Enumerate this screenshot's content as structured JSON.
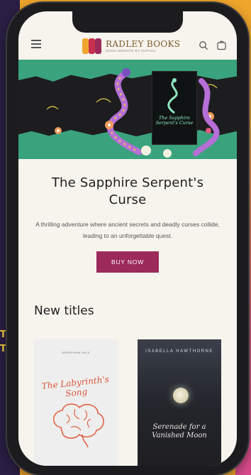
{
  "colors": {
    "background": "#f0a62c",
    "hero_bg": "#3aa37e",
    "buy_button": "#9c2a5b",
    "screen_bg": "#f7f4ee",
    "logo_marks": [
      "#f0a62c",
      "#c9304f",
      "#9c2a5b"
    ]
  },
  "header": {
    "brand_title": "RADLEY BOOKS",
    "brand_subtitle": "DEMO WEBSITE BY SUPADU",
    "icons": [
      "menu-icon",
      "search-icon",
      "cart-icon"
    ]
  },
  "hero": {
    "book": {
      "title": "The Sapphire Serpent's Curse"
    }
  },
  "featured": {
    "title": "The Sapphire Serpent's Curse",
    "description": "A thrilling adventure where ancient secrets and deadly curses collide, leading to an unforgettable quest.",
    "button_label": "BUY NOW"
  },
  "new_titles": {
    "heading": "New titles",
    "books": [
      {
        "author": "SERAPHINA VALE",
        "title": "The Labyrinth's Song"
      },
      {
        "author": "ISABELLA HAWTHORNE",
        "title": "Serenade for a Vanished Moon"
      }
    ]
  }
}
